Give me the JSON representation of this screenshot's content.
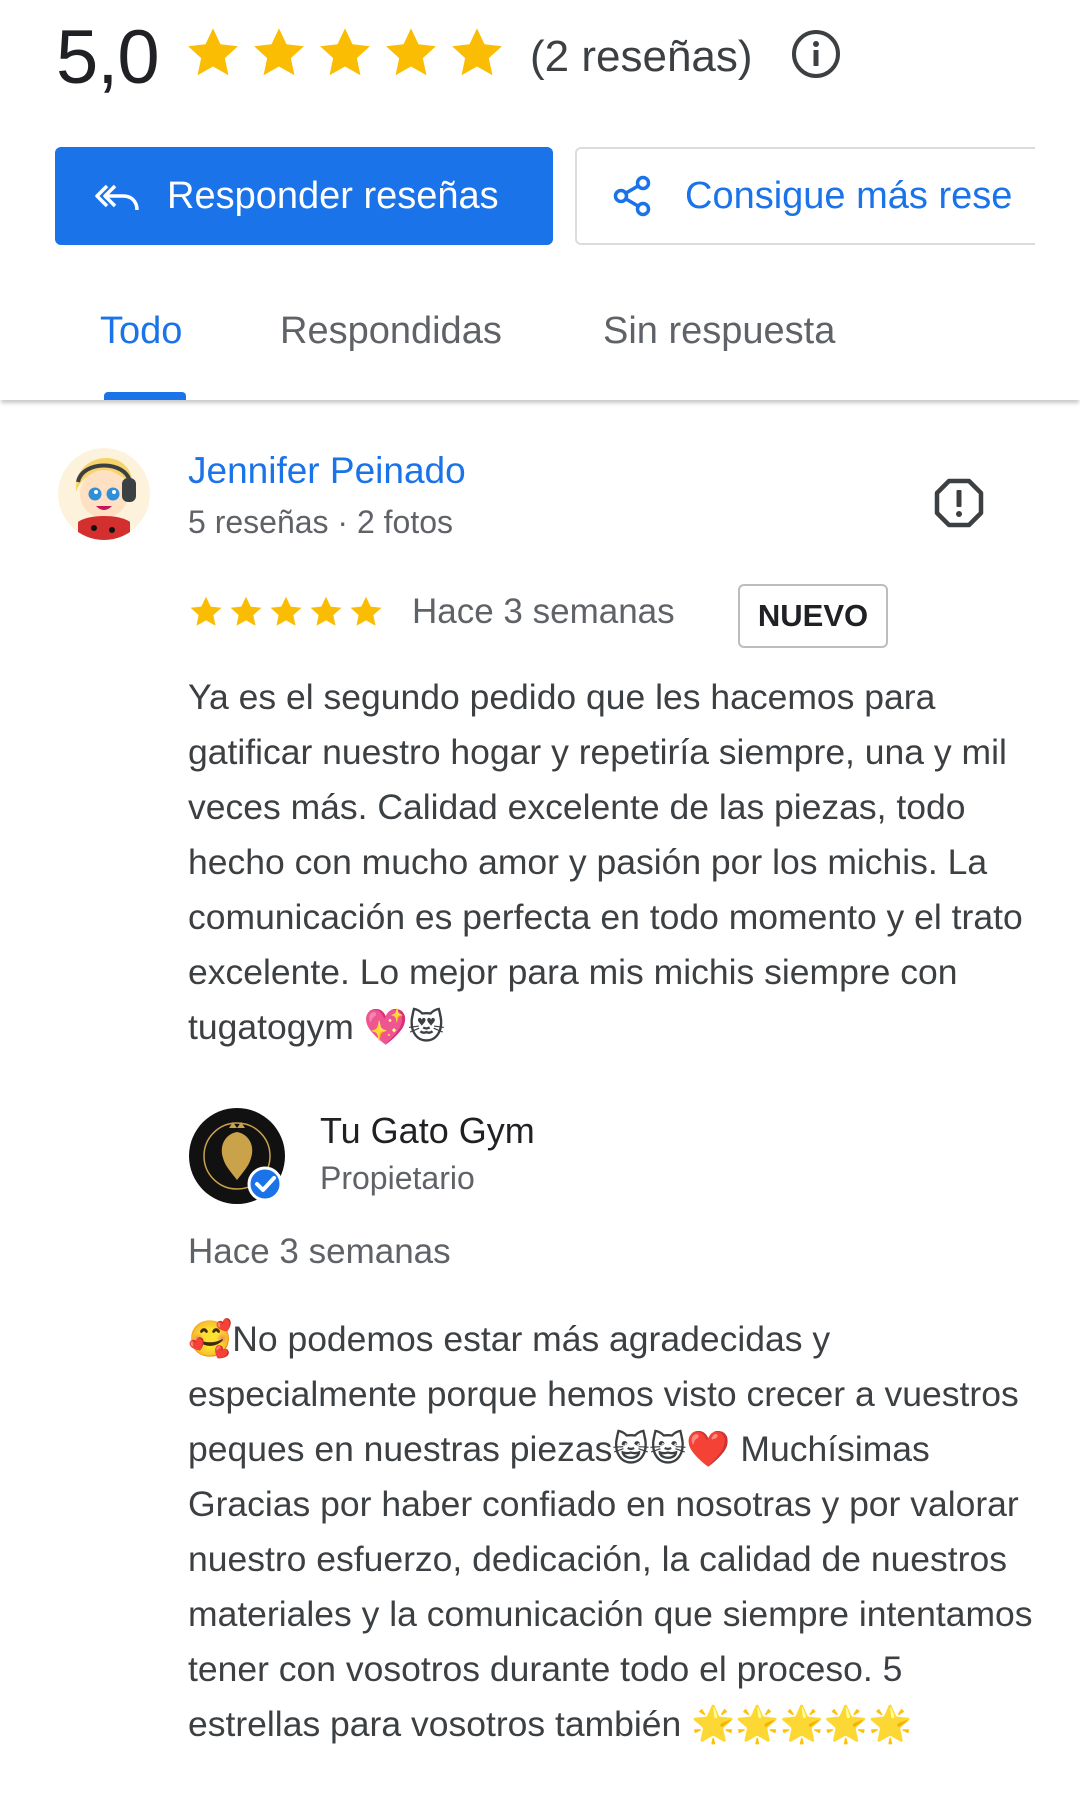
{
  "summary": {
    "rating": "5,0",
    "stars_filled": 5,
    "review_count_label": "(2 reseñas)",
    "star_color": "#fbbc04"
  },
  "actions": {
    "reply_reviews": "Responder reseñas",
    "get_more_reviews": "Consigue más rese"
  },
  "tabs": [
    {
      "label": "Todo",
      "active": true
    },
    {
      "label": "Respondidas",
      "active": false
    },
    {
      "label": "Sin respuesta",
      "active": false
    }
  ],
  "review": {
    "author": "Jennifer Peinado",
    "author_meta": "5 reseñas · 2 fotos",
    "stars": 5,
    "date": "Hace 3 semanas",
    "badge": "NUEVO",
    "text": "Ya es el segundo pedido que les hacemos para gatificar nuestro hogar y repetiría siempre, una y mil veces más. Calidad excelente de las piezas, todo hecho con mucho amor y pasión por los michis. La comunicación es perfecta en todo momento y el trato excelente. Lo mejor para mis michis siempre con tugatogym 💖😻"
  },
  "reply": {
    "owner_name": "Tu Gato Gym",
    "owner_role": "Propietario",
    "logo_text": "CIRCUITOS DE PARED PARA GATOS",
    "date": "Hace 3 semanas",
    "text": "🥰No podemos estar más agradecidas y especialmente porque hemos visto crecer a vuestros peques en nuestras piezas😺😺❤️ Muchísimas Gracias por haber confiado en nosotras y por valorar nuestro esfuerzo, dedicación, la calidad de nuestros materiales y la comunicación que siempre intentamos tener con vosotros durante todo el proceso. 5 estrellas para vosotros también 🌟🌟🌟🌟🌟"
  },
  "colors": {
    "accent": "#1a73e8",
    "text_secondary": "#5f6368"
  }
}
